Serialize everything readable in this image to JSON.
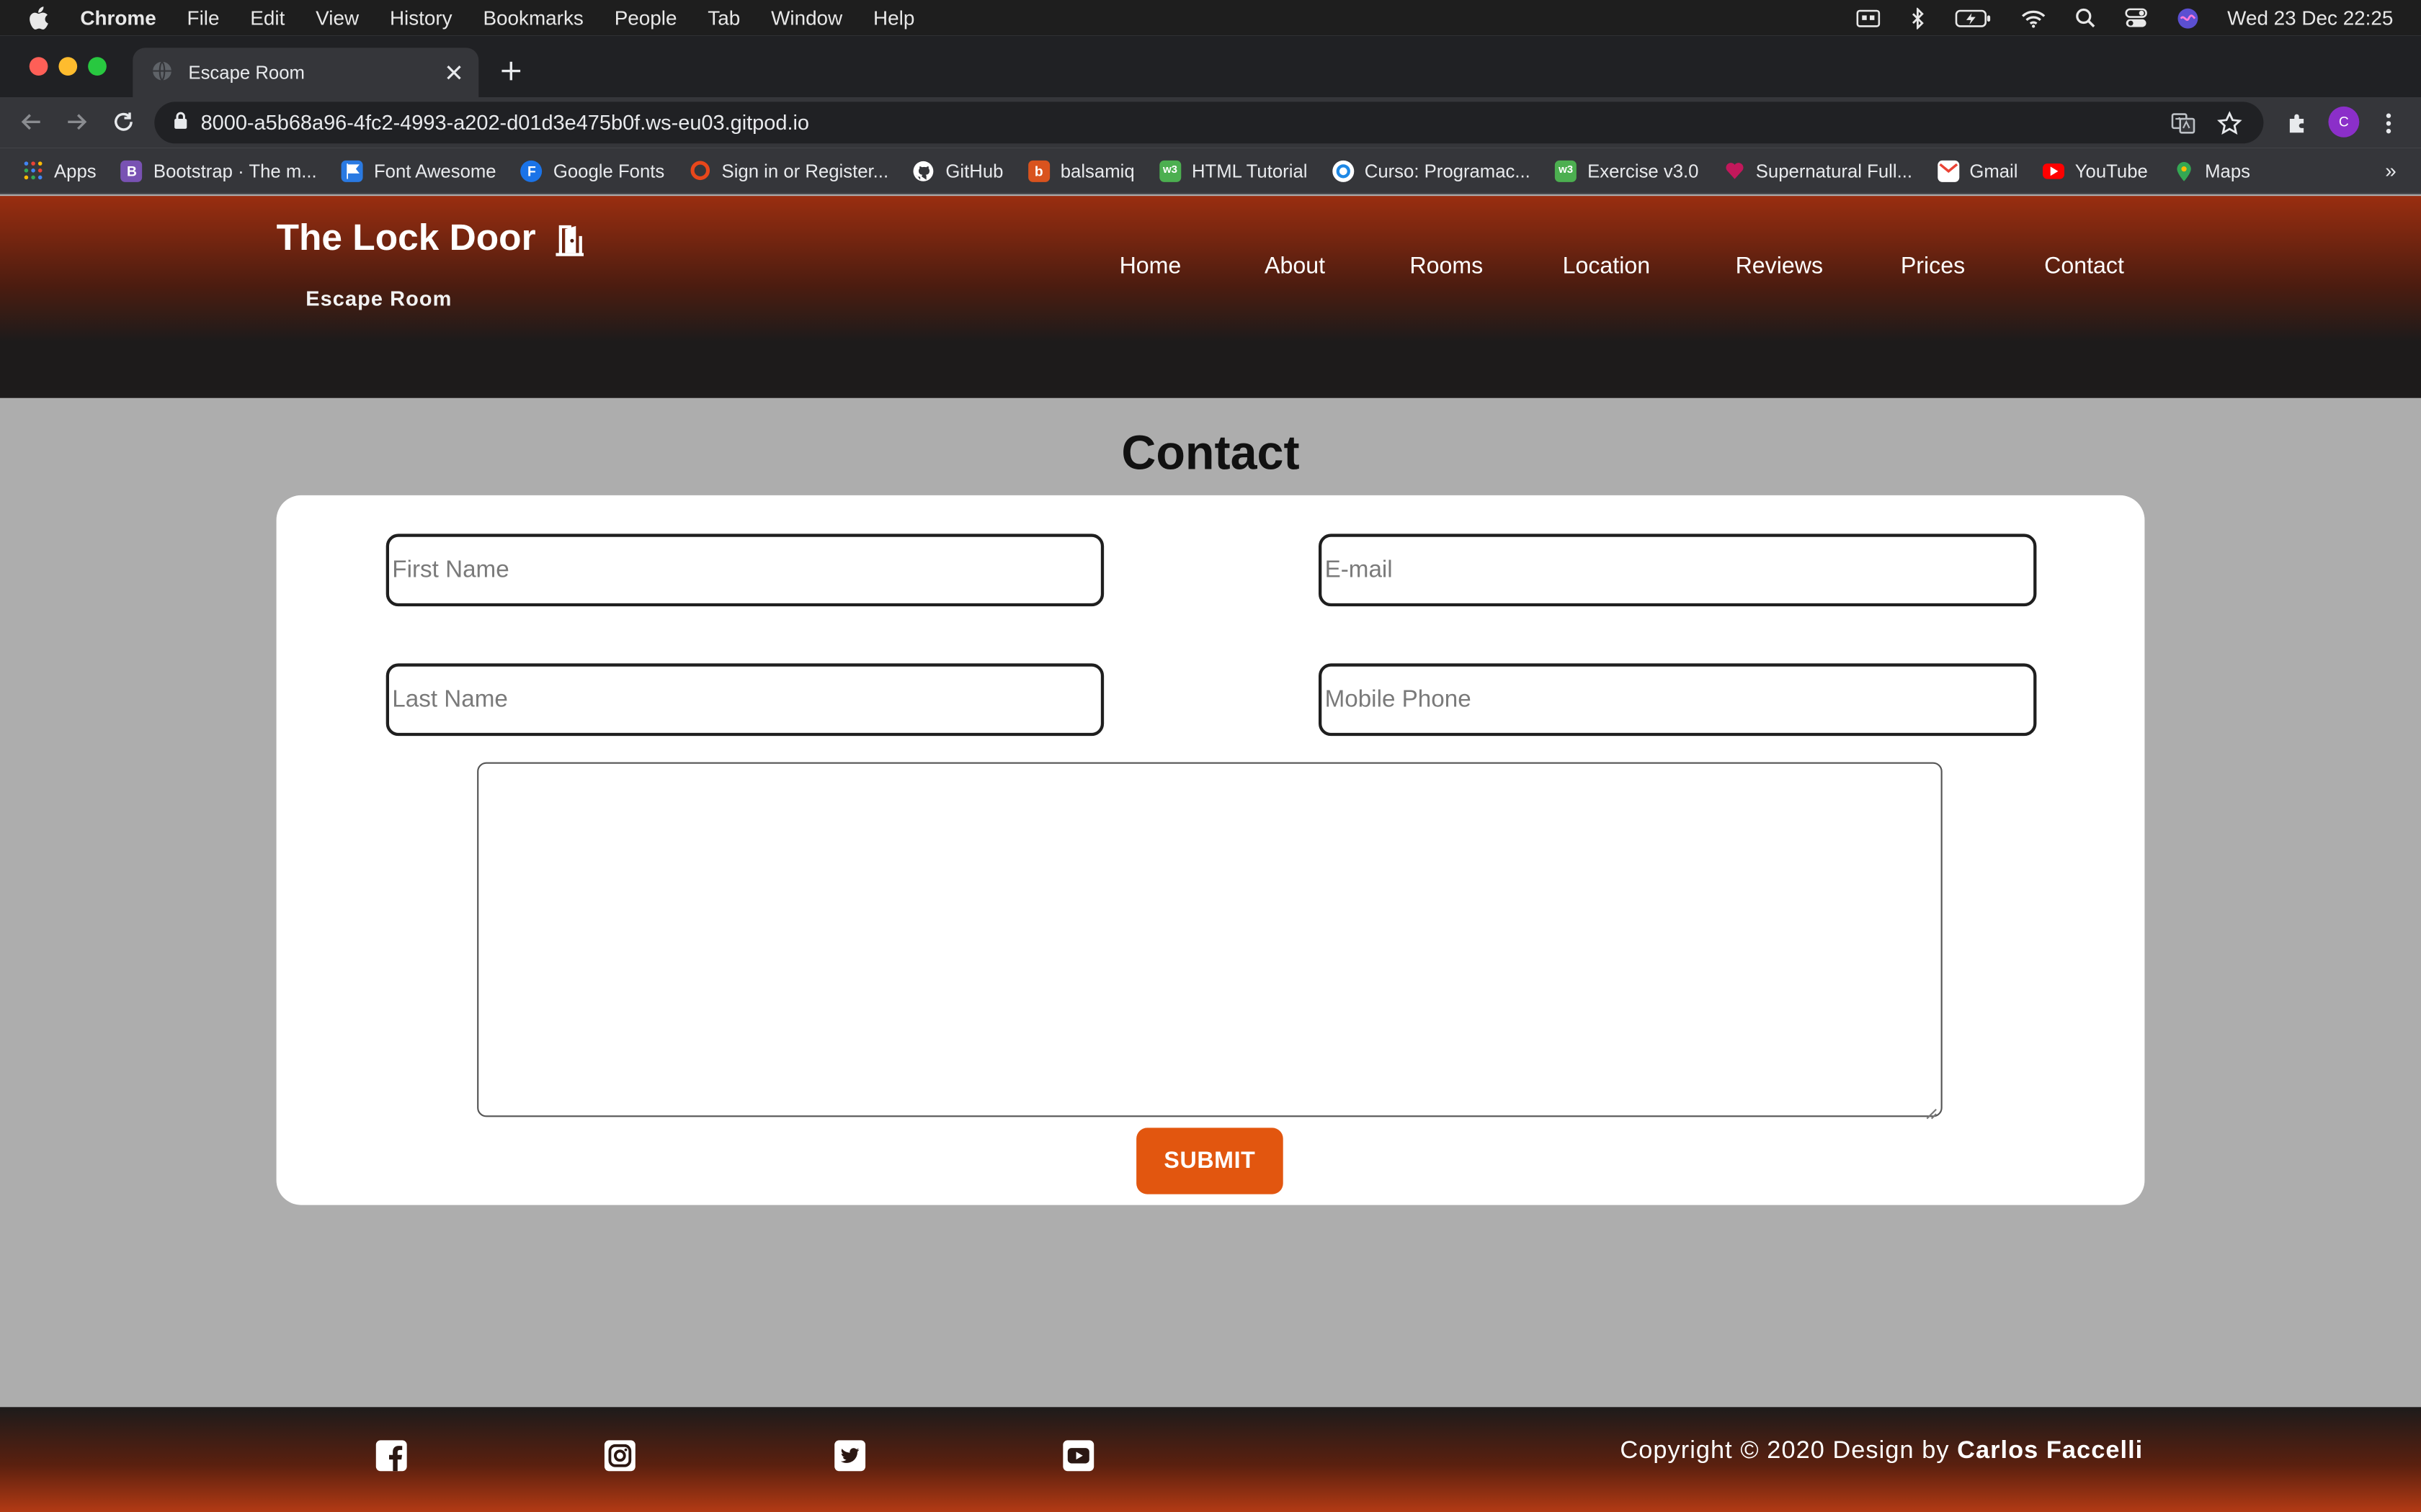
{
  "macos_menubar": {
    "app_name": "Chrome",
    "menus": [
      "File",
      "Edit",
      "View",
      "History",
      "Bookmarks",
      "People",
      "Tab",
      "Window",
      "Help"
    ],
    "clock": "Wed 23 Dec  22:25"
  },
  "browser": {
    "tab_title": "Escape Room",
    "url": "8000-a5b68a96-4fc2-4993-a202-d01d3e475b0f.ws-eu03.gitpod.io",
    "avatar_letter": "C",
    "bookmarks": [
      {
        "label": "Apps",
        "icon": "apps-grid-icon",
        "color": "#4285f4"
      },
      {
        "label": "Bootstrap · The m...",
        "icon": "bootstrap-icon",
        "color": "#7952b3"
      },
      {
        "label": "Font Awesome",
        "icon": "flag-icon",
        "color": "#2a7ae2"
      },
      {
        "label": "Google Fonts",
        "icon": "google-fonts-icon",
        "color": "#1a73e8"
      },
      {
        "label": "Sign in or Register...",
        "icon": "ring-icon",
        "color": "#e8471b"
      },
      {
        "label": "GitHub",
        "icon": "github-icon",
        "color": "#ffffff"
      },
      {
        "label": "balsamiq",
        "icon": "balsamiq-icon",
        "color": "#d9531e"
      },
      {
        "label": "HTML Tutorial",
        "icon": "w3schools-icon",
        "color": "#4caf50"
      },
      {
        "label": "Curso: Programac...",
        "icon": "course-icon",
        "color": "#1e88e5"
      },
      {
        "label": "Exercise v3.0",
        "icon": "w3schools-icon",
        "color": "#4caf50"
      },
      {
        "label": "Supernatural Full...",
        "icon": "heart-icon",
        "color": "#c2185b"
      },
      {
        "label": "Gmail",
        "icon": "gmail-icon",
        "color": "#ea4335"
      },
      {
        "label": "YouTube",
        "icon": "youtube-icon",
        "color": "#ff0000"
      },
      {
        "label": "Maps",
        "icon": "maps-icon",
        "color": "#34a853"
      }
    ],
    "bookmarks_overflow": "»"
  },
  "site": {
    "brand": "The Lock Door",
    "brand_subtitle": "Escape Room",
    "nav": [
      "Home",
      "About",
      "Rooms",
      "Location",
      "Reviews",
      "Prices",
      "Contact"
    ],
    "accent_color": "#e2560f"
  },
  "contact": {
    "title": "Contact",
    "fields": {
      "first_name_placeholder": "First Name",
      "email_placeholder": "E-mail",
      "last_name_placeholder": "Last Name",
      "mobile_placeholder": "Mobile Phone"
    },
    "submit_label": "SUBMIT"
  },
  "footer": {
    "social": [
      "facebook-icon",
      "instagram-icon",
      "twitter-icon",
      "youtube-icon"
    ],
    "copyright_prefix": "Copyright © 2020 Design by ",
    "author": "Carlos Faccelli"
  }
}
